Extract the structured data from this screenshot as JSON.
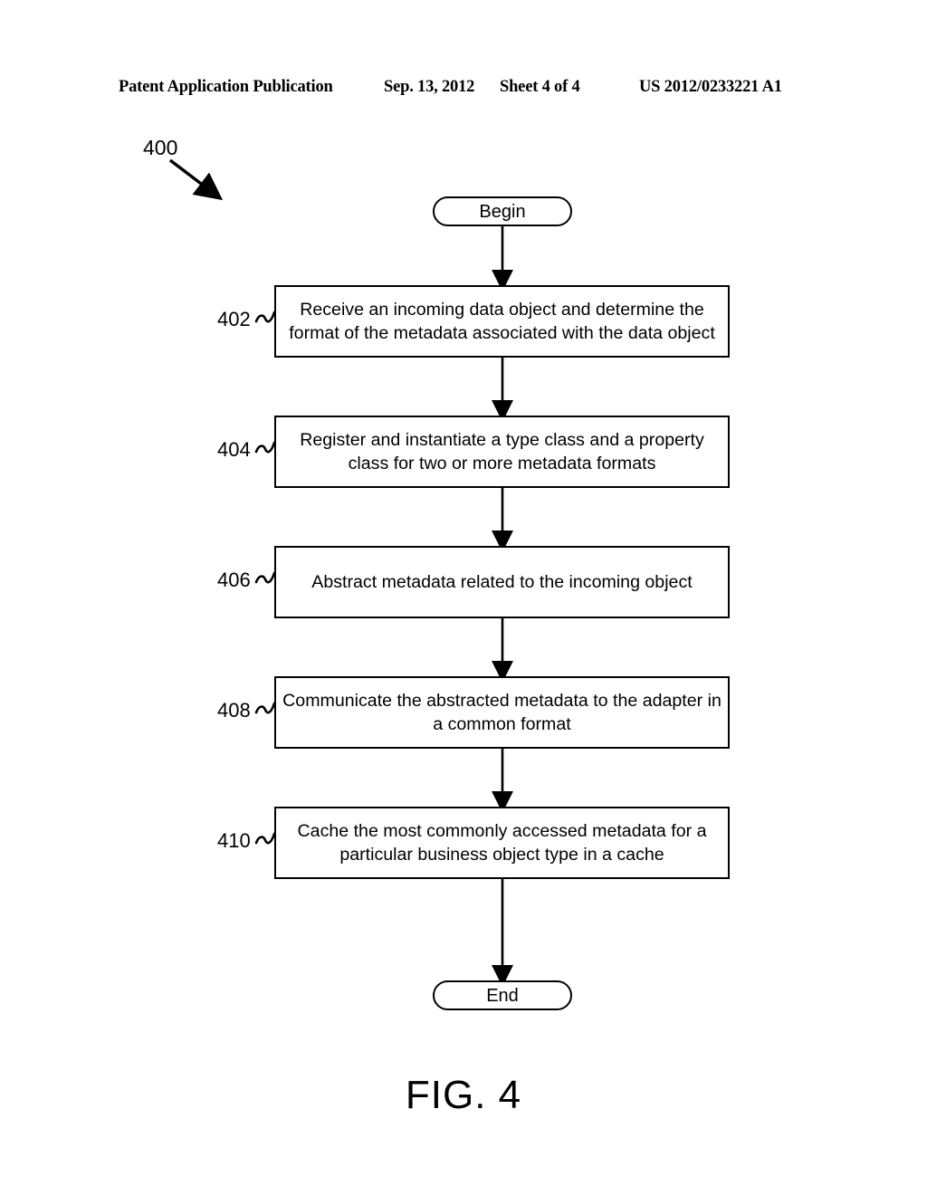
{
  "header": {
    "publication": "Patent Application Publication",
    "date": "Sep. 13, 2012",
    "sheet": "Sheet 4 of 4",
    "patent_number": "US 2012/0233221 A1"
  },
  "figure": {
    "reference_numeral": "400",
    "caption": "FIG. 4"
  },
  "flowchart": {
    "type": "flowchart",
    "orientation": "vertical",
    "start_node": {
      "label": "Begin",
      "shape": "terminator"
    },
    "end_node": {
      "label": "End",
      "shape": "terminator"
    },
    "steps": [
      {
        "number": "402",
        "shape": "process",
        "text": "Receive an incoming data object and determine the\nformat of the metadata associated with the data object"
      },
      {
        "number": "404",
        "shape": "process",
        "text": "Register and instantiate a type class and a property\nclass for two or more metadata formats"
      },
      {
        "number": "406",
        "shape": "process",
        "text": "Abstract metadata related to the incoming object"
      },
      {
        "number": "408",
        "shape": "process",
        "text": "Communicate the abstracted metadata to the adapter in\na common format"
      },
      {
        "number": "410",
        "shape": "process",
        "text": "Cache the most commonly accessed metadata for a\nparticular business object type in a cache"
      }
    ],
    "connectors": [
      {
        "from": "Begin",
        "to": "402",
        "style": "arrow-down"
      },
      {
        "from": "402",
        "to": "404",
        "style": "arrow-down"
      },
      {
        "from": "404",
        "to": "406",
        "style": "arrow-down"
      },
      {
        "from": "406",
        "to": "408",
        "style": "arrow-down"
      },
      {
        "from": "408",
        "to": "410",
        "style": "arrow-down"
      },
      {
        "from": "410",
        "to": "End",
        "style": "arrow-down"
      }
    ]
  },
  "colors": {
    "background": "#ffffff",
    "ink": "#000000"
  }
}
